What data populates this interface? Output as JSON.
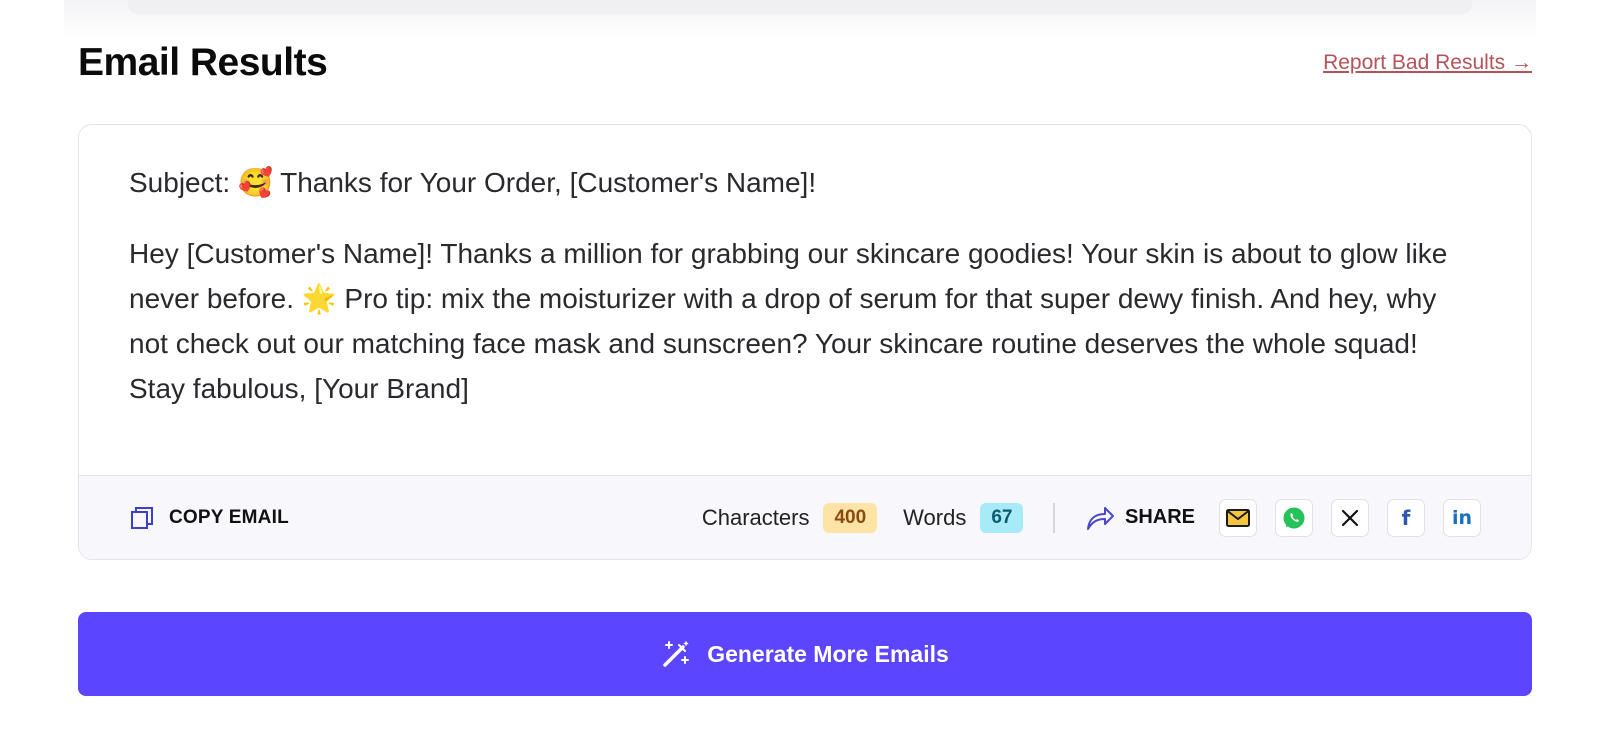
{
  "header": {
    "title": "Email Results",
    "report_link": "Report Bad Results →"
  },
  "email": {
    "subject": "Subject: 🥰 Thanks for Your Order, [Customer's Name]!",
    "body": "Hey [Customer's Name]! Thanks a million for grabbing our skincare goodies! Your skin is about to glow like never before. 🌟 Pro tip: mix the moisturizer with a drop of serum for that super dewy finish. And hey, why not check out our matching face mask and sunscreen? Your skincare routine deserves the whole squad! Stay fabulous, [Your Brand]"
  },
  "footer": {
    "copy_label": "COPY EMAIL",
    "characters_label": "Characters",
    "characters_value": "400",
    "words_label": "Words",
    "words_value": "67",
    "share_label": "SHARE",
    "share_icons": [
      "email-icon",
      "whatsapp-icon",
      "x-icon",
      "facebook-icon",
      "linkedin-icon"
    ],
    "facebook_glyph": "f",
    "linkedin_glyph": "in"
  },
  "actions": {
    "generate_label": "Generate More Emails"
  },
  "colors": {
    "accent": "#5b45fe",
    "report_link": "#b4535a",
    "characters_badge": "#fde3a6",
    "words_badge": "#a6ebf7"
  }
}
